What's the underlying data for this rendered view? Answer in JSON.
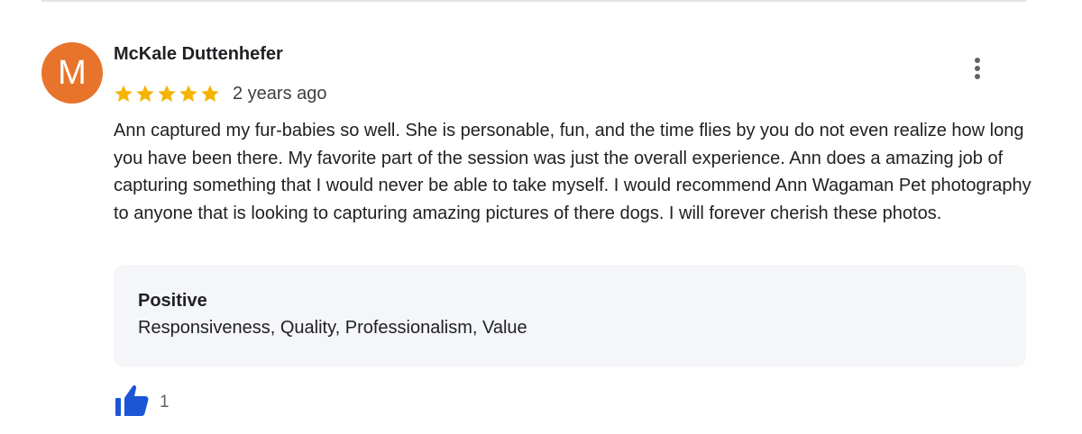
{
  "review": {
    "avatar_initial": "M",
    "avatar_color": "#e8742c",
    "author": "McKale Duttenhefer",
    "rating": 5,
    "rating_max": 5,
    "star_color": "#f4b400",
    "age": "2 years ago",
    "more_icon": "more-vertical-icon",
    "text": "Ann captured my fur-babies so well. She is personable, fun, and the time flies by you do not even realize how long you have been there. My favorite part of the session was just the overall experience. Ann does a amazing job of capturing something that I would never be able to take myself. I would recommend Ann Wagaman Pet photography to anyone that is looking to capturing amazing pictures of there dogs. I will forever cherish these photos.",
    "attributes": {
      "heading": "Positive",
      "values": "Responsiveness, Quality, Professionalism, Value"
    },
    "like_icon": "thumbs-up-icon",
    "like_color": "#1a56d6",
    "like_count": "1"
  }
}
